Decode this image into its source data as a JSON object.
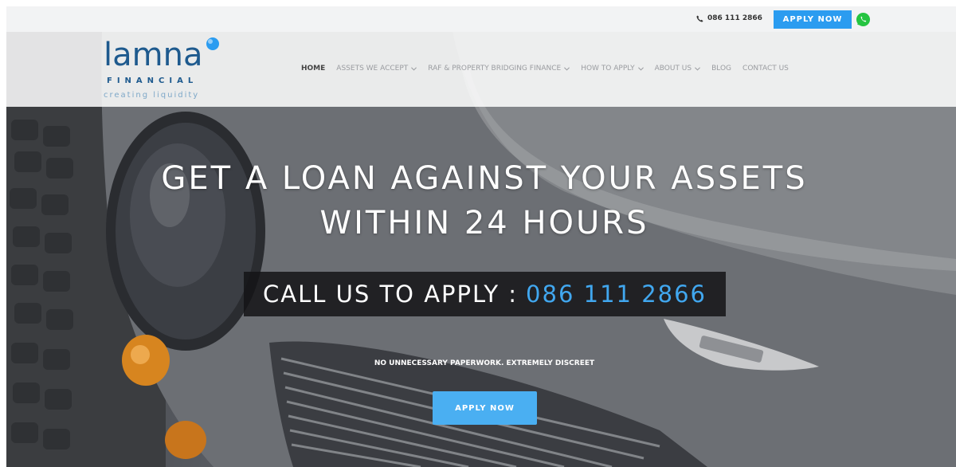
{
  "topbar": {
    "phone": "086 111 2866",
    "apply_label": "APPLY NOW",
    "icons": [
      "phone-icon",
      "whatsapp-icon"
    ]
  },
  "brand": {
    "name": "lamna",
    "sub": "FINANCIAL",
    "tagline": "creating liquidity",
    "colors": {
      "primary": "#1e5a8e",
      "accent": "#2b9cf0"
    }
  },
  "nav": {
    "items": [
      {
        "label": "HOME",
        "active": true,
        "has_dropdown": false
      },
      {
        "label": "ASSETS WE ACCEPT",
        "active": false,
        "has_dropdown": true
      },
      {
        "label": "RAF & PROPERTY BRIDGING FINANCE",
        "active": false,
        "has_dropdown": true
      },
      {
        "label": "HOW TO APPLY",
        "active": false,
        "has_dropdown": true
      },
      {
        "label": "ABOUT US",
        "active": false,
        "has_dropdown": true
      },
      {
        "label": "BLOG",
        "active": false,
        "has_dropdown": false
      },
      {
        "label": "CONTACT US",
        "active": false,
        "has_dropdown": false
      }
    ]
  },
  "hero": {
    "headline_line1": "GET A LOAN AGAINST YOUR ASSETS",
    "headline_line2": "WITHIN 24 HOURS",
    "call_label": "CALL US TO APPLY :",
    "call_number": "086 111 2866",
    "tagline": "NO UNNECESSARY PAPERWORK. EXTREMELY DISCREET",
    "apply_label": "APPLY NOW"
  }
}
